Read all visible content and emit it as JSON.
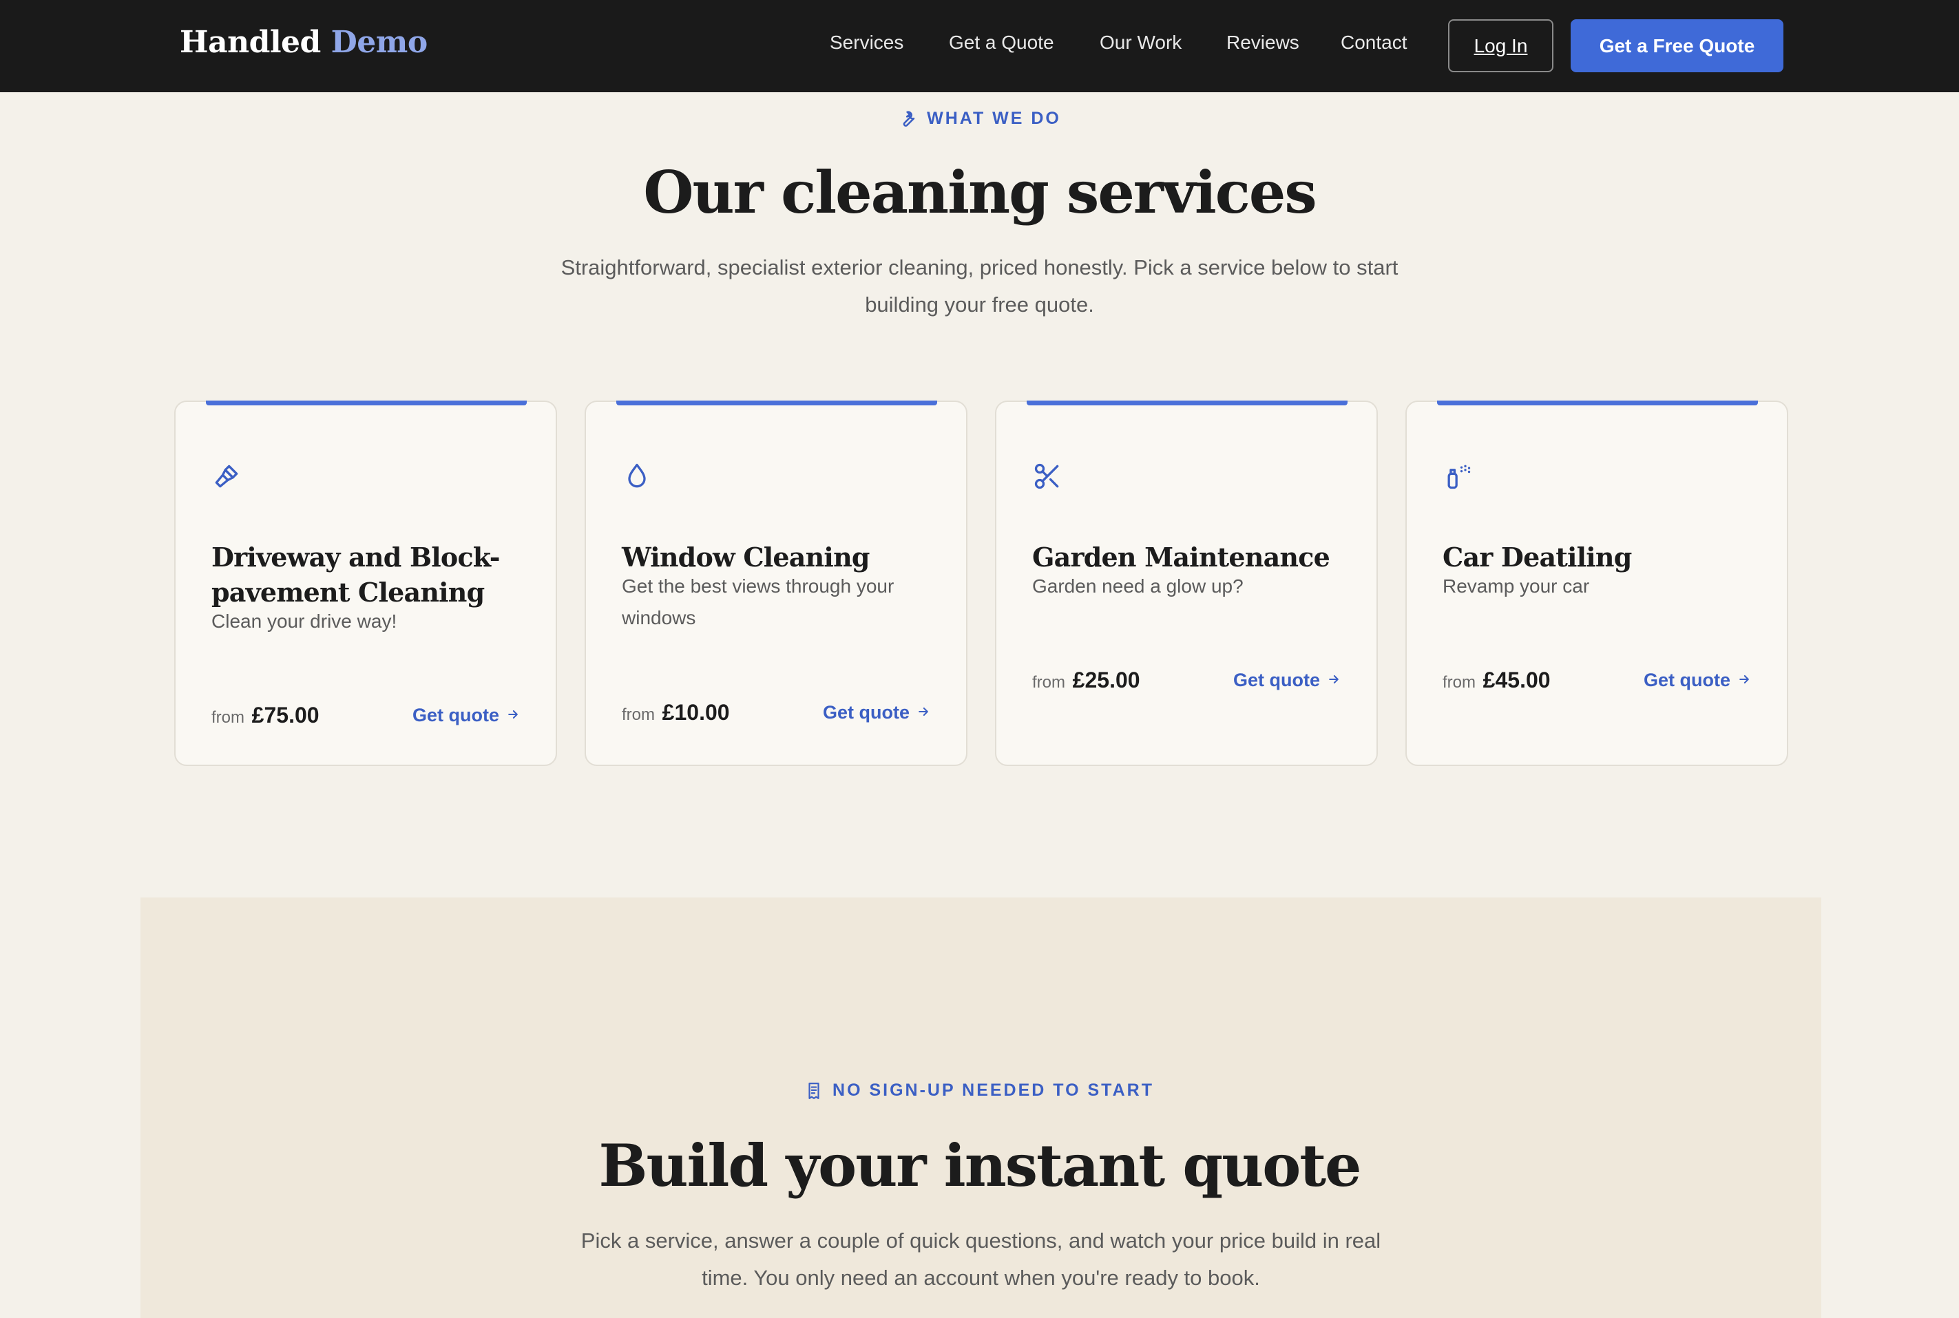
{
  "nav": {
    "brand_main": "Handled",
    "brand_accent": "Demo",
    "links": [
      "Services",
      "Get a Quote",
      "Our Work",
      "Reviews",
      "Contact"
    ],
    "login_label": "Log In",
    "cta_label": "Get a Free Quote"
  },
  "services": {
    "eyebrow": "WHAT WE DO",
    "title": "Our cleaning services",
    "subtitle_line1": "Straightforward, specialist exterior cleaning, priced honestly. Pick a service below to start",
    "subtitle_line2": "building your free quote.",
    "cards": [
      {
        "icon": "brush-icon",
        "title": "Driveway and Block-pavement Cleaning",
        "description": "Clean your drive way!",
        "price_prefix": "from",
        "price": "£75.00",
        "link_label": "Get quote"
      },
      {
        "icon": "droplet-icon",
        "title": "Window Cleaning",
        "description": "Get the best views through your windows",
        "price_prefix": "from",
        "price": "£10.00",
        "link_label": "Get quote"
      },
      {
        "icon": "scissors-icon",
        "title": "Garden Maintenance",
        "description": "Garden need a glow up?",
        "price_prefix": "from",
        "price": "£25.00",
        "link_label": "Get quote"
      },
      {
        "icon": "spray-bottle-icon",
        "title": "Car Deatiling",
        "description": "Revamp your car",
        "price_prefix": "from",
        "price": "£45.00",
        "link_label": "Get quote"
      }
    ]
  },
  "quote": {
    "eyebrow": "NO SIGN-UP NEEDED TO START",
    "title": "Build your instant quote",
    "subtitle_line1": "Pick a service, answer a couple of quick questions, and watch your price build in real",
    "subtitle_line2": "time. You only need an account when you're ready to book."
  },
  "colors": {
    "nav_bg": "#1a1a1a",
    "accent": "#3f6ad8",
    "page_bg": "#f4f1ea",
    "quote_bg": "#efe8db"
  }
}
